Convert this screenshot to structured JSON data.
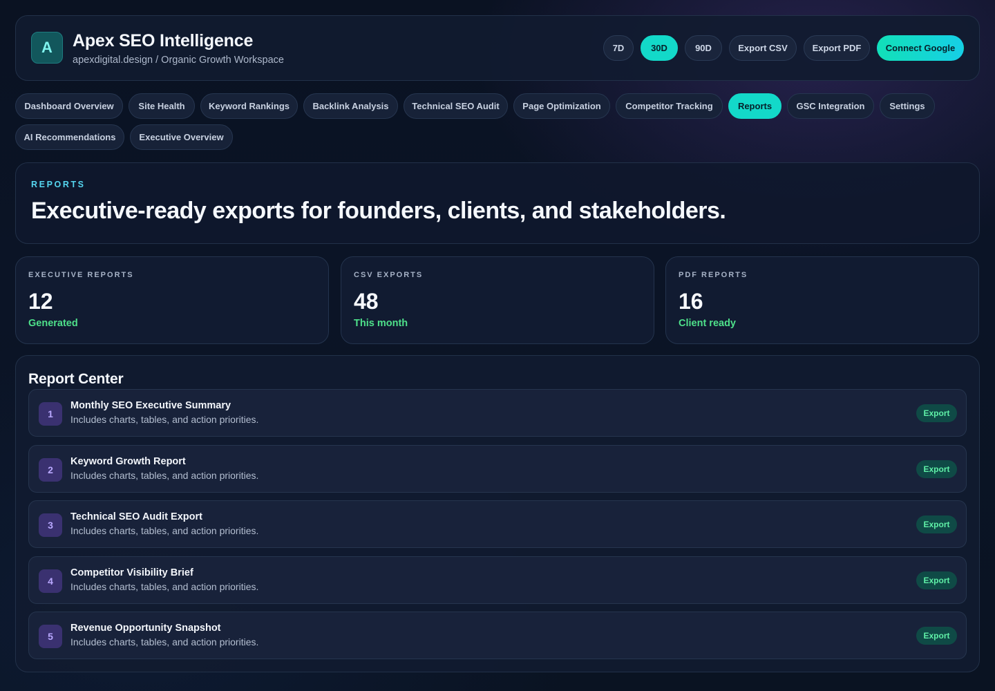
{
  "header": {
    "logo_letter": "A",
    "title": "Apex SEO Intelligence",
    "subtitle": "apexdigital.design / Organic Growth Workspace",
    "ranges": [
      "7D",
      "30D",
      "90D"
    ],
    "active_range": "30D",
    "export_csv": "Export CSV",
    "export_pdf": "Export PDF",
    "connect": "Connect Google"
  },
  "nav": {
    "tabs": [
      "Dashboard Overview",
      "Site Health",
      "Keyword Rankings",
      "Backlink Analysis",
      "Technical SEO Audit",
      "Page Optimization",
      "Competitor Tracking",
      "Reports",
      "GSC Integration",
      "Settings",
      "AI Recommendations",
      "Executive Overview"
    ],
    "active": "Reports"
  },
  "hero": {
    "eyebrow": "REPORTS",
    "title": "Executive-ready exports for founders, clients, and stakeholders."
  },
  "stats": [
    {
      "label": "EXECUTIVE REPORTS",
      "value": "12",
      "note": "Generated"
    },
    {
      "label": "CSV EXPORTS",
      "value": "48",
      "note": "This month"
    },
    {
      "label": "PDF REPORTS",
      "value": "16",
      "note": "Client ready"
    }
  ],
  "report_center": {
    "title": "Report Center",
    "reports": [
      {
        "num": "1",
        "title": "Monthly SEO Executive Summary",
        "desc": "Includes charts, tables, and action priorities.",
        "action": "Export"
      },
      {
        "num": "2",
        "title": "Keyword Growth Report",
        "desc": "Includes charts, tables, and action priorities.",
        "action": "Export"
      },
      {
        "num": "3",
        "title": "Technical SEO Audit Export",
        "desc": "Includes charts, tables, and action priorities.",
        "action": "Export"
      },
      {
        "num": "4",
        "title": "Competitor Visibility Brief",
        "desc": "Includes charts, tables, and action priorities.",
        "action": "Export"
      },
      {
        "num": "5",
        "title": "Revenue Opportunity Snapshot",
        "desc": "Includes charts, tables, and action priorities.",
        "action": "Export"
      }
    ]
  },
  "colors": {
    "accent": "#13d9c9",
    "positive": "#4ee08a",
    "eyebrow": "#55d6f0",
    "badge": "#3a3170"
  }
}
